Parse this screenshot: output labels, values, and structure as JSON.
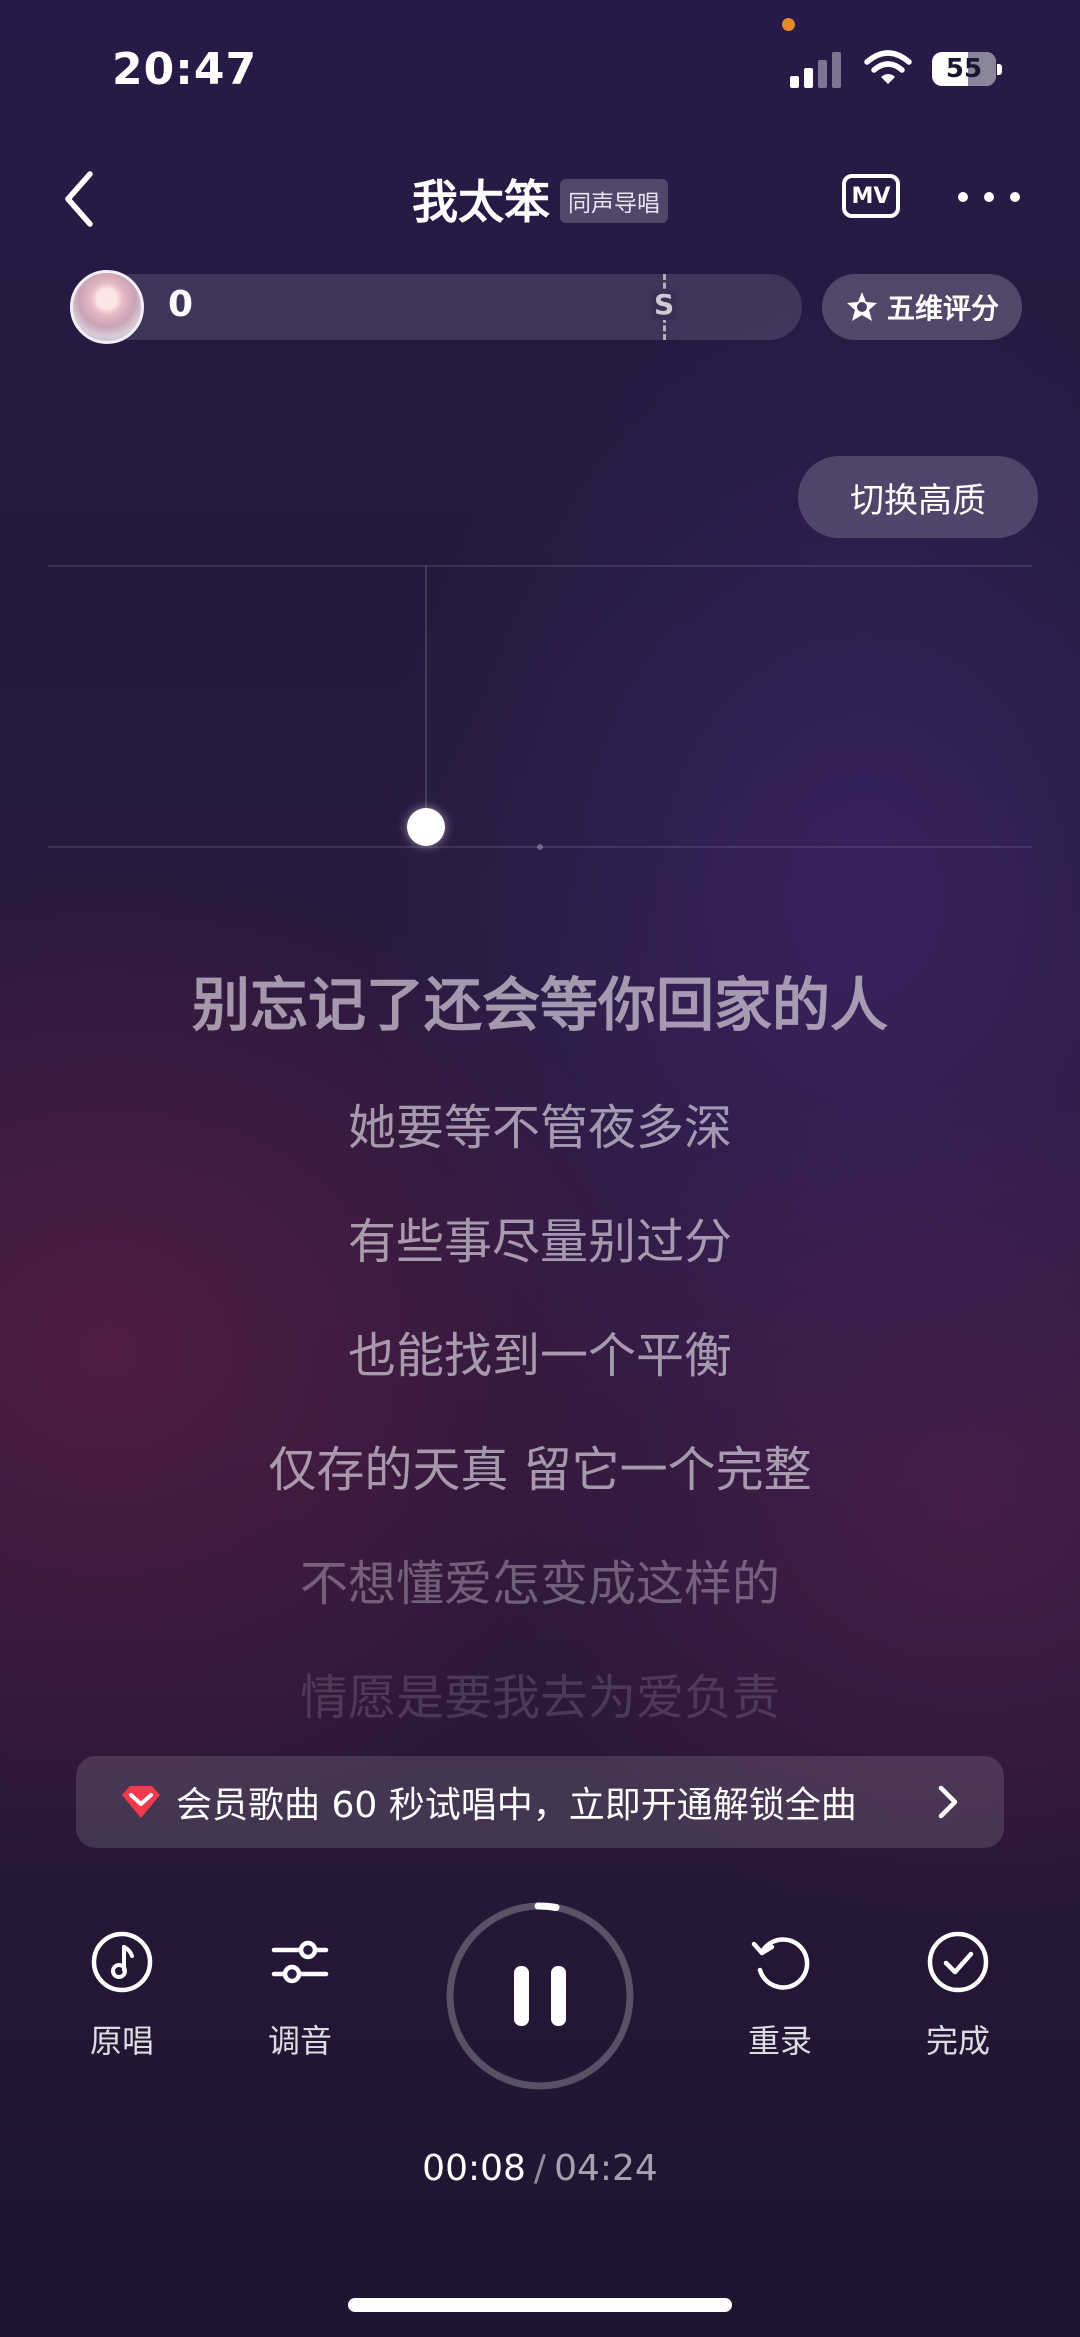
{
  "status_bar": {
    "time": "20:47",
    "battery": "55"
  },
  "header": {
    "title": "我太笨",
    "title_badge": "同声导唱",
    "mv_label": "MV",
    "back_icon": "chevron-left-icon",
    "more_icon": "more-dots-icon"
  },
  "score": {
    "value": "0",
    "grade_marker": "S",
    "five_dim_label": "五维评分"
  },
  "quality_switch_label": "切换高质",
  "lyrics": {
    "current": "别忘记了还会等你回家的人",
    "upcoming": [
      "她要等不管夜多深",
      "有些事尽量别过分",
      "也能找到一个平衡",
      "仅存的天真 留它一个完整",
      "不想懂爱怎变成这样的",
      "情愿是要我去为爱负责"
    ]
  },
  "member_banner": {
    "text": "会员歌曲 60 秒试唱中，立即开通解锁全曲",
    "icon": "diamond-vip-icon",
    "accent": "#f03a4b"
  },
  "controls": {
    "original_label": "原唱",
    "tuning_label": "调音",
    "rerecord_label": "重录",
    "finish_label": "完成",
    "play_state": "paused-icon"
  },
  "playback": {
    "current_time": "00:08",
    "separator": "/",
    "total_time": "04:24",
    "progress_fraction": 0.031
  }
}
